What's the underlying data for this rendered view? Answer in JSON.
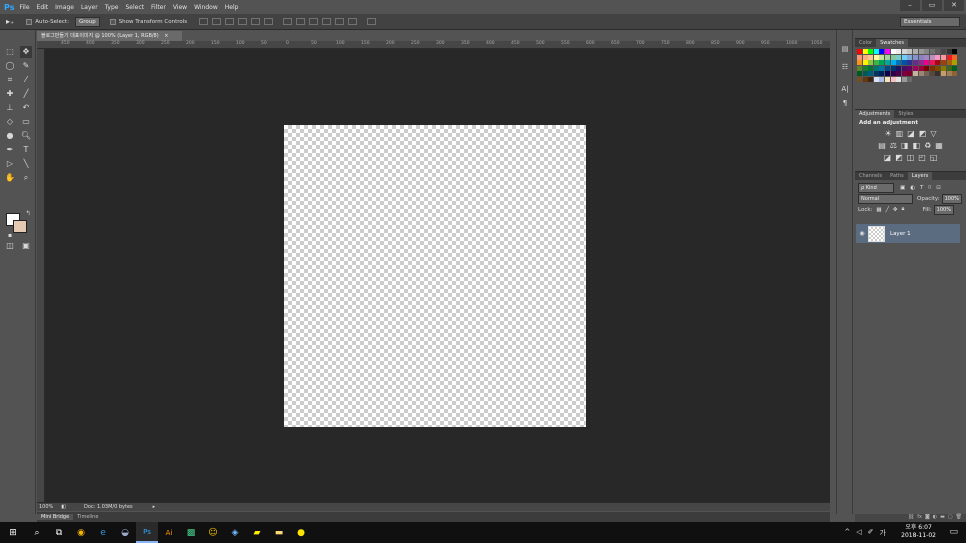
{
  "app": {
    "logo": "Ps"
  },
  "menu": [
    "File",
    "Edit",
    "Image",
    "Layer",
    "Type",
    "Select",
    "Filter",
    "View",
    "Window",
    "Help"
  ],
  "window_controls": [
    "–",
    "▭",
    "✕"
  ],
  "options_bar": {
    "auto_select_label": "Auto-Select:",
    "auto_select_value": "Group",
    "transform_label": "Show Transform Controls",
    "workspace": "Essentials"
  },
  "document": {
    "tab_title": "블로그만들기 대표이미지 @ 100% (Layer 1, RGB/8)",
    "tab_close": "×",
    "ruler_marks": [
      "450",
      "400",
      "350",
      "300",
      "250",
      "200",
      "150",
      "100",
      "50",
      "0",
      "50",
      "100",
      "150",
      "200",
      "250",
      "300",
      "350",
      "400",
      "450",
      "500",
      "550",
      "600",
      "650",
      "700",
      "750",
      "800",
      "850",
      "900",
      "950",
      "1000",
      "1050"
    ],
    "zoom": "100%",
    "doc_info": "Doc: 1.03M/0 bytes"
  },
  "bottom_tabs": [
    "Mini Bridge",
    "Timeline"
  ],
  "panels": {
    "color_tabs": [
      "Color",
      "Swatches"
    ],
    "swatch_colors": [
      "#ff0000",
      "#ffff00",
      "#00ff00",
      "#00ffff",
      "#0000ff",
      "#ff00ff",
      "#ffffff",
      "#ebebeb",
      "#d6d6d6",
      "#c2c2c2",
      "#adadad",
      "#999999",
      "#858585",
      "#707070",
      "#5c5c5c",
      "#474747",
      "#333333",
      "#000000",
      "#f7977a",
      "#f9ad81",
      "#fdc68a",
      "#fff79a",
      "#c4df9b",
      "#a3d39c",
      "#82ca9d",
      "#7bcdc8",
      "#6ecff6",
      "#7ea7d8",
      "#8493ca",
      "#8882be",
      "#a187be",
      "#bc8dbf",
      "#f49ac2",
      "#f6989d",
      "#ed1c24",
      "#f26522",
      "#f7941d",
      "#fff200",
      "#8dc63f",
      "#39b54a",
      "#00a651",
      "#00a99d",
      "#00aeef",
      "#0072bc",
      "#0054a6",
      "#2e3192",
      "#662d91",
      "#92278f",
      "#ec008c",
      "#ed145b",
      "#9e0b0f",
      "#a0410d",
      "#a3620a",
      "#aba000",
      "#598527",
      "#197b30",
      "#007236",
      "#00746b",
      "#0076a3",
      "#004b80",
      "#003471",
      "#1b1464",
      "#440e62",
      "#630460",
      "#9e005d",
      "#9e0039",
      "#790000",
      "#7b2e00",
      "#7d4900",
      "#827b00",
      "#406618",
      "#005e20",
      "#005826",
      "#005952",
      "#005b7f",
      "#003663",
      "#002157",
      "#0d004c",
      "#32004b",
      "#4b0049",
      "#7b0046",
      "#7a0026",
      "#c7b299",
      "#998675",
      "#736357",
      "#534741",
      "#37302d",
      "#c69c6d",
      "#a67c52",
      "#8c6239",
      "#754c24",
      "#603913",
      "#41240f",
      "#d8e0f8",
      "#a9bde8",
      "#f6e1bd",
      "#f6c0c7",
      "#e3e3e3",
      "#9a9a9a",
      "#6a6a6a"
    ],
    "adjust_tabs": [
      "Adjustments",
      "Styles"
    ],
    "adjust_title": "Add an adjustment",
    "adjust_row1": [
      "☀",
      "▥",
      "◪",
      "◩",
      "▽"
    ],
    "adjust_row2": [
      "▤",
      "⚖",
      "◨",
      "◧",
      "♻",
      "▦"
    ],
    "adjust_row3": [
      "◪",
      "◩",
      "◫",
      "◰",
      "◱"
    ],
    "layer_tabs": [
      "Channels",
      "Paths",
      "Layers"
    ],
    "filter_kind": "ρ Kind",
    "blend_mode": "Normal",
    "opacity_label": "Opacity:",
    "opacity_value": "100%",
    "lock_label": "Lock:",
    "fill_label": "Fill:",
    "fill_value": "100%",
    "layer_name": "Layer 1"
  },
  "taskbar": {
    "clock_time": "오후 6:07",
    "clock_date": "2018-11-02",
    "ime": "가"
  }
}
